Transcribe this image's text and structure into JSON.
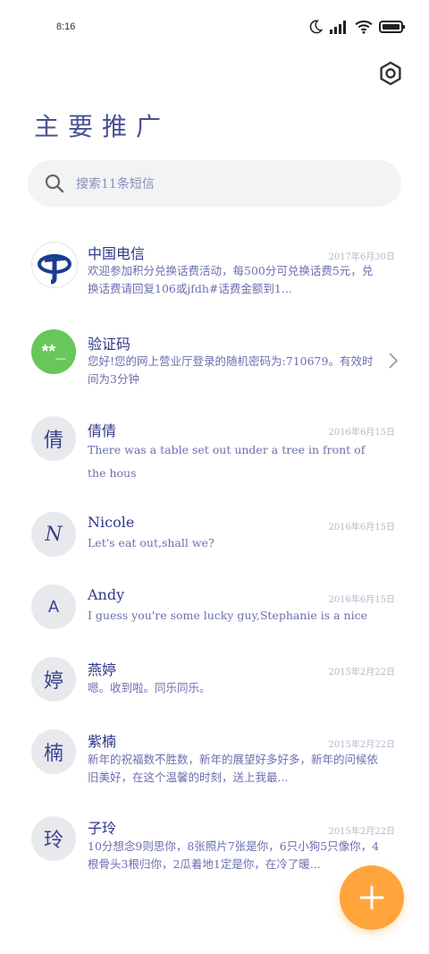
{
  "status_bar": {
    "time": "8:16"
  },
  "header": {
    "title": "主要推广"
  },
  "search": {
    "placeholder": "搜索11条短信"
  },
  "conversations": [
    {
      "name": "中国电信",
      "date": "2017年6月30日",
      "snippet": "欢迎参加积分兑换话费活动，每500分可兑换话费5元，兑换话费请回复106或jfdh#话费金额到1...",
      "avatar": "telecom-logo"
    },
    {
      "name": "验证码",
      "date": "",
      "snippet": "您好!您的网上营业厅登录的随机密码为:710679。有效时间为3分钟",
      "avatar_text": "**_"
    },
    {
      "name": "倩倩",
      "date": "2016年6月15日",
      "snippet": "There was a table set out under a tree in front of the hous",
      "avatar_text": "倩"
    },
    {
      "name": "Nicole",
      "date": "2016年6月15日",
      "snippet": "Let's eat out,shall we?",
      "avatar_text": "N"
    },
    {
      "name": "Andy",
      "date": "2016年6月15日",
      "snippet": "I guess you're some lucky guy,Stephanie is a nice girl.",
      "avatar_text": "A"
    },
    {
      "name": "燕婷",
      "date": "2015年2月22日",
      "snippet": "嗯。收到啦。同乐同乐。",
      "avatar_text": "婷"
    },
    {
      "name": "紫楠",
      "date": "2015年2月22日",
      "snippet": "新年的祝福数不胜数，新年的展望好多好多，新年的问候依旧美好，在这个温馨的时刻，送上我最...",
      "avatar_text": "楠"
    },
    {
      "name": "子玲",
      "date": "2015年2月22日",
      "snippet": "10分想念9则思你，8张照片7张是你，6只小狗5只像你，4根骨头3根归你，2瓜着地1定是你，在冷了暖...",
      "avatar_text": "玲"
    }
  ],
  "colors": {
    "accent": "#ffa53b",
    "verify_avatar": "#67c75a",
    "telecom_blue": "#1a3d8f"
  }
}
